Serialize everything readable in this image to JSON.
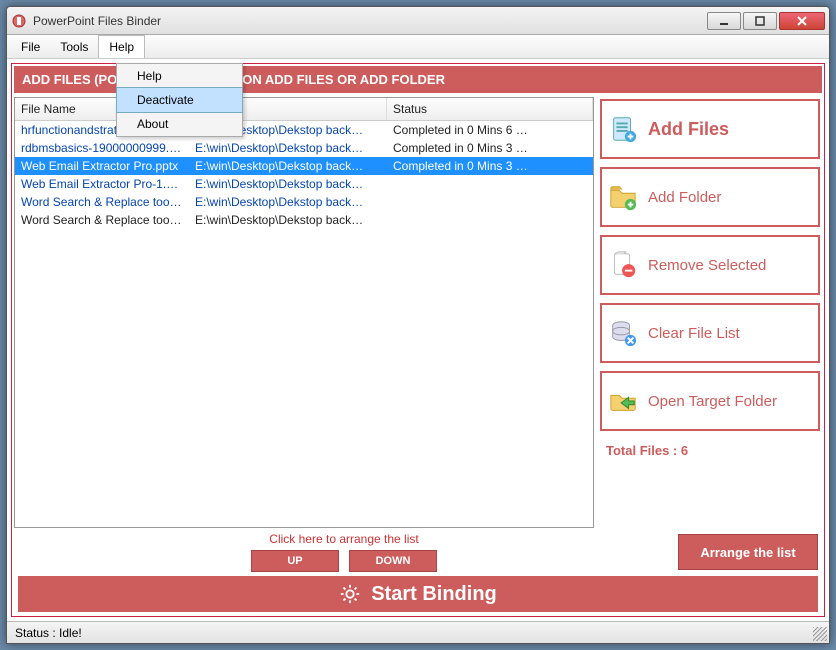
{
  "window": {
    "title": "PowerPoint Files Binder"
  },
  "menubar": {
    "file": "File",
    "tools": "Tools",
    "help": "Help"
  },
  "helpMenu": {
    "help": "Help",
    "deactivate": "Deactivate",
    "about": "About"
  },
  "banner": "ADD FILES (POWERPOINT), CLICK ON ADD FILES OR ADD FOLDER",
  "columns": {
    "c1": "File Name",
    "c2": "",
    "c3": "Status"
  },
  "rows": [
    {
      "name": "hrfunctionandstrategyppt.ppt",
      "path": "E:\\win\\Desktop\\Dekstop back…",
      "status": "Completed in 0 Mins 6 …",
      "selected": false,
      "link": true
    },
    {
      "name": "rdbmsbasics-19000000999.…",
      "path": "E:\\win\\Desktop\\Dekstop back…",
      "status": "Completed in 0 Mins 3 …",
      "selected": false,
      "link": true
    },
    {
      "name": "Web Email Extractor Pro.pptx",
      "path": "E:\\win\\Desktop\\Dekstop back…",
      "status": "Completed in 0 Mins 3 …",
      "selected": true,
      "link": true
    },
    {
      "name": "Web Email Extractor Pro-1.…",
      "path": "E:\\win\\Desktop\\Dekstop back…",
      "status": "",
      "selected": false,
      "link": true
    },
    {
      "name": "Word Search & Replace too…",
      "path": "E:\\win\\Desktop\\Dekstop back…",
      "status": "",
      "selected": false,
      "link": true
    },
    {
      "name": "Word Search & Replace too…",
      "path": "E:\\win\\Desktop\\Dekstop back…",
      "status": "",
      "selected": false,
      "link": false
    }
  ],
  "side": {
    "addFiles": "Add Files",
    "addFolder": "Add Folder",
    "removeSelected": "Remove Selected",
    "clearList": "Clear File List",
    "openTarget": "Open Target Folder",
    "total": "Total Files : 6"
  },
  "arrange": {
    "hint": "Click here to arrange the list",
    "up": "UP",
    "down": "DOWN",
    "btn": "Arrange the list"
  },
  "start": "Start Binding",
  "status": "Status  :  Idle!"
}
